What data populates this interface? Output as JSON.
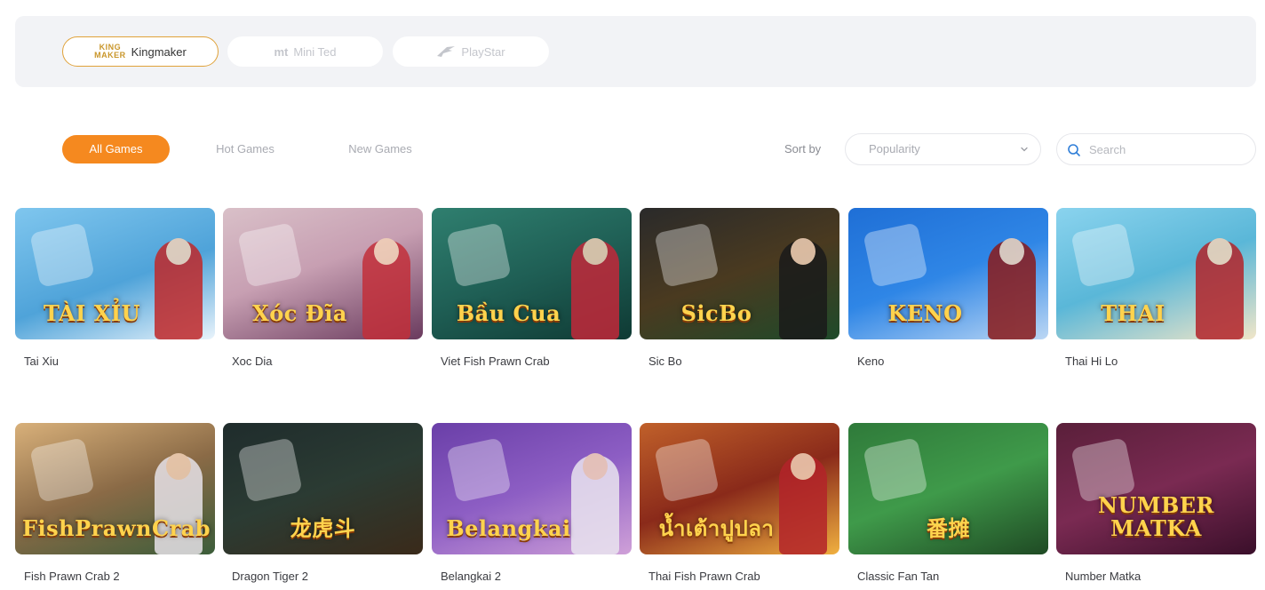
{
  "providers": [
    {
      "label": "Kingmaker",
      "logo_text_top": "KING",
      "logo_text_bottom": "MAKER",
      "active": true
    },
    {
      "label": "Mini Ted",
      "logo_text": "mt",
      "active": false
    },
    {
      "label": "PlayStar",
      "active": false
    }
  ],
  "tabs": [
    {
      "label": "All Games",
      "active": true
    },
    {
      "label": "Hot Games",
      "active": false
    },
    {
      "label": "New Games",
      "active": false
    }
  ],
  "sort": {
    "label": "Sort by",
    "value": "Popularity"
  },
  "search": {
    "placeholder": "Search"
  },
  "colors": {
    "accent": "#f5891f",
    "provider_border": "#e0a23a"
  },
  "games": [
    {
      "name": "Tai Xiu",
      "art_text": "TÀI XỈU",
      "bg": "linear-gradient(160deg,#7fc6ee 0%,#4fa3d9 55%,#e9f3fb 100%)",
      "figure": "#c0282a"
    },
    {
      "name": "Xoc Dia",
      "art_text": "Xóc Đĩa",
      "bg": "linear-gradient(160deg,#d9c0c8 0%,#c79fb2 45%,#6a3b5e 100%)",
      "figure": "#c22f3a"
    },
    {
      "name": "Viet Fish Prawn Crab",
      "art_text": "Bầu Cua",
      "bg": "linear-gradient(160deg,#2f7f6f 0%,#1f5f55 50%,#0f3a34 100%)",
      "figure": "#c2283a"
    },
    {
      "name": "Sic Bo",
      "art_text": "SicBo",
      "bg": "linear-gradient(160deg,#2a2a2a 0%,#4a3a20 50%,#1e4a2a 100%)",
      "figure": "#1a1a1a"
    },
    {
      "name": "Keno",
      "art_text": "KENO",
      "bg": "linear-gradient(160deg,#1f6fd6 0%,#2f86e6 50%,#bcd7f4 100%)",
      "figure": "#8a1a1a"
    },
    {
      "name": "Thai Hi Lo",
      "art_text": "THAI",
      "bg": "linear-gradient(160deg,#8ad3ee 0%,#5ab7d8 50%,#f1e6c8 100%)",
      "figure": "#b3242a"
    },
    {
      "name": "Fish Prawn Crab 2",
      "art_text": "FishPrawnCrab",
      "bg": "linear-gradient(160deg,#d8b07a 0%,#8a6a46 50%,#3b5d3a 100%)",
      "figure": "#e7e2e8"
    },
    {
      "name": "Dragon Tiger 2",
      "art_text": "龙虎斗",
      "bg": "linear-gradient(160deg,#1f2c2c 0%,#2b3b33 50%,#3a2a1a 100%)",
      "figure": "transparent"
    },
    {
      "name": "Belangkai 2",
      "art_text": "Belangkai",
      "bg": "linear-gradient(160deg,#6a3fa8 0%,#8d5ec4 50%,#cfa0d8 100%)",
      "figure": "#e9e4ef"
    },
    {
      "name": "Thai Fish Prawn Crab",
      "art_text": "น้ำเต้าปูปลา",
      "bg": "linear-gradient(160deg,#c0602a 0%,#8a2a1a 50%,#f0b040 100%)",
      "figure": "#b3242a"
    },
    {
      "name": "Classic Fan Tan",
      "art_text": "番摊",
      "bg": "linear-gradient(160deg,#2f7a3a 0%,#3f9a4a 50%,#1f4a24 100%)",
      "figure": "transparent"
    },
    {
      "name": "Number Matka",
      "art_text": "NUMBER MATKA",
      "bg": "linear-gradient(160deg,#5a1f3a 0%,#7a2a52 50%,#3a0f2a 100%)",
      "figure": "transparent"
    }
  ]
}
